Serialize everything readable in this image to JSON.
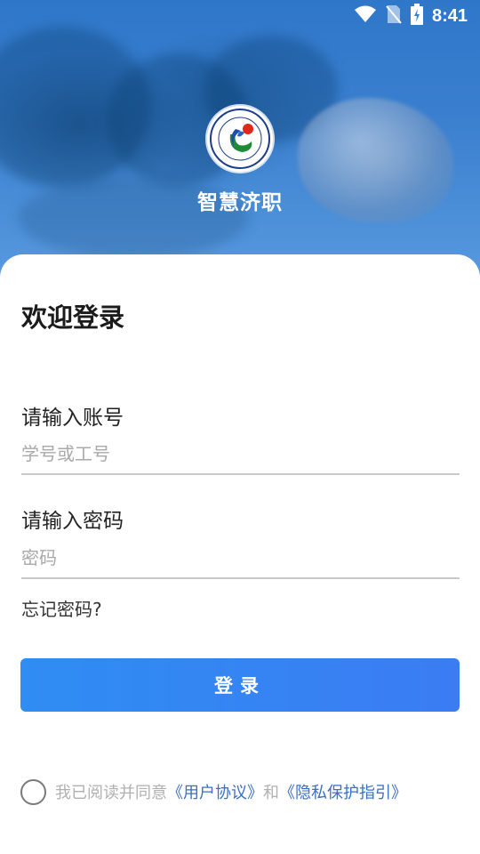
{
  "status_bar": {
    "time": "8:41",
    "icons": [
      "wifi-icon",
      "no-sim-icon",
      "battery-charging-icon"
    ]
  },
  "header": {
    "app_name": "智慧济职",
    "logo": "school-emblem-logo"
  },
  "login": {
    "title": "欢迎登录",
    "account": {
      "label": "请输入账号",
      "placeholder": "学号或工号",
      "value": ""
    },
    "password": {
      "label": "请输入密码",
      "placeholder": "密码",
      "value": ""
    },
    "forgot_label": "忘记密码?",
    "submit_label": "登录"
  },
  "agreement": {
    "prefix": "我已阅读并同意",
    "user_agreement": "《用户协议》",
    "joiner": "和",
    "privacy": "《隐私保护指引》",
    "checked": false
  },
  "colors": {
    "primary": "#2f8df3",
    "link": "#3a6fc4",
    "header_bg": "#3a7fcf"
  }
}
